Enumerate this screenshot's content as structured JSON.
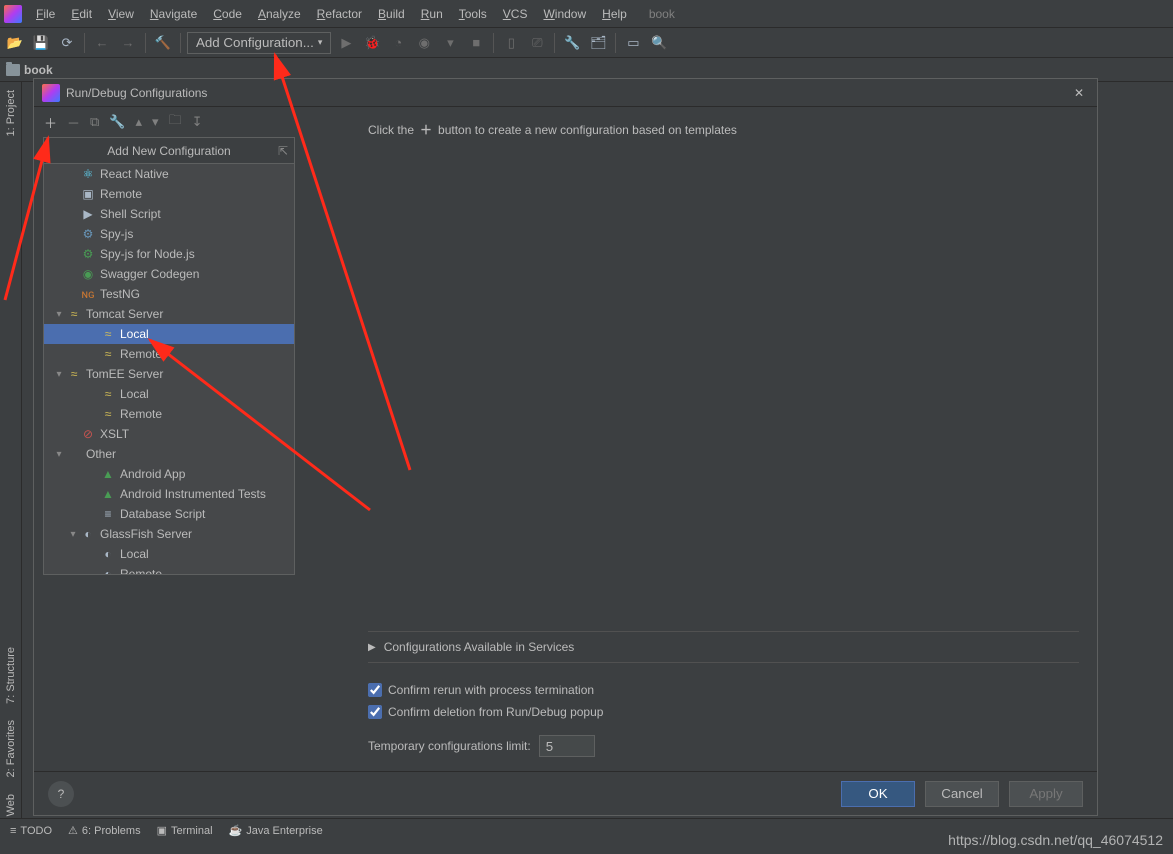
{
  "menus": [
    "File",
    "Edit",
    "View",
    "Navigate",
    "Code",
    "Analyze",
    "Refactor",
    "Build",
    "Run",
    "Tools",
    "VCS",
    "Window",
    "Help"
  ],
  "projectNameTop": "book",
  "toolbar": {
    "addConfigLabel": "Add Configuration..."
  },
  "breadcrumb": {
    "project": "book"
  },
  "leftStrip": {
    "project": "1: Project",
    "structure": "7: Structure",
    "favorites": "2: Favorites",
    "web": "Web"
  },
  "dialog": {
    "title": "Run/Debug Configurations",
    "popupHeader": "Add New Configuration",
    "hintPrefix": "Click the",
    "hintSuffix": "button to create a new configuration based on templates",
    "services": "Configurations Available in Services",
    "confirmRerun": "Confirm rerun with process termination",
    "confirmDelete": "Confirm deletion from Run/Debug popup",
    "limitLabel": "Temporary configurations limit:",
    "limitValue": "5",
    "ok": "OK",
    "cancel": "Cancel",
    "apply": "Apply"
  },
  "configs": [
    {
      "label": "React Native",
      "icon": "⚛",
      "cls": "i-react",
      "indent": 1
    },
    {
      "label": "Remote",
      "icon": "▣",
      "cls": "i-grey2",
      "indent": 1
    },
    {
      "label": "Shell Script",
      "icon": "▶",
      "cls": "i-grey2",
      "indent": 1
    },
    {
      "label": "Spy-js",
      "icon": "⚙",
      "cls": "i-blue",
      "indent": 1
    },
    {
      "label": "Spy-js for Node.js",
      "icon": "⚙",
      "cls": "i-green",
      "indent": 1
    },
    {
      "label": "Swagger Codegen",
      "icon": "◉",
      "cls": "i-green",
      "indent": 1
    },
    {
      "label": "TestNG",
      "icon": "ɴɢ",
      "cls": "i-orange",
      "indent": 1
    },
    {
      "label": "Tomcat Server",
      "icon": "≈",
      "cls": "i-yellow",
      "indent": 0,
      "expand": "▾"
    },
    {
      "label": "Local",
      "icon": "≈",
      "cls": "i-yellow",
      "indent": 2,
      "selected": true
    },
    {
      "label": "Remote",
      "icon": "≈",
      "cls": "i-yellow",
      "indent": 2
    },
    {
      "label": "TomEE Server",
      "icon": "≈",
      "cls": "i-yellow",
      "indent": 0,
      "expand": "▾"
    },
    {
      "label": "Local",
      "icon": "≈",
      "cls": "i-yellow",
      "indent": 2
    },
    {
      "label": "Remote",
      "icon": "≈",
      "cls": "i-yellow",
      "indent": 2
    },
    {
      "label": "XSLT",
      "icon": "⊘",
      "cls": "i-red",
      "indent": 1
    },
    {
      "label": "Other",
      "icon": "",
      "cls": "",
      "indent": 0,
      "expand": "▾"
    },
    {
      "label": "Android App",
      "icon": "▲",
      "cls": "i-green",
      "indent": 2
    },
    {
      "label": "Android Instrumented Tests",
      "icon": "▲",
      "cls": "i-green",
      "indent": 2
    },
    {
      "label": "Database Script",
      "icon": "≡",
      "cls": "i-grey2",
      "indent": 2
    },
    {
      "label": "GlassFish Server",
      "icon": "◐",
      "cls": "i-grey2",
      "indent": 1,
      "expand": "▾"
    },
    {
      "label": "Local",
      "icon": "◐",
      "cls": "i-grey2",
      "indent": 2
    },
    {
      "label": "Remote",
      "icon": "◐",
      "cls": "i-grey2",
      "indent": 2
    }
  ],
  "bottomBar": {
    "todo": "TODO",
    "problems": "6: Problems",
    "terminal": "Terminal",
    "java": "Java Enterprise"
  },
  "watermark": "https://blog.csdn.net/qq_46074512"
}
